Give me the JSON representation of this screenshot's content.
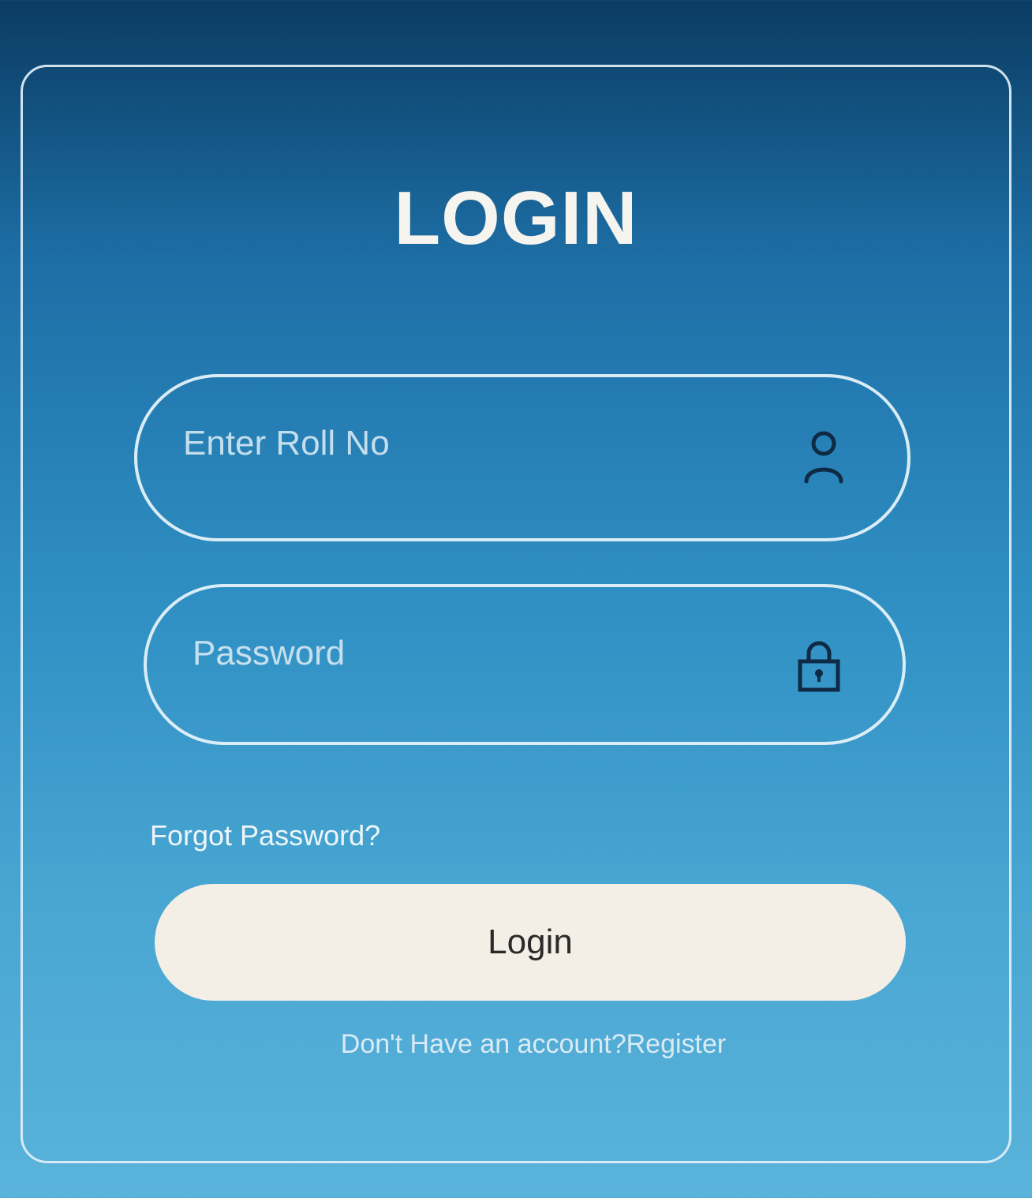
{
  "form": {
    "title": "LOGIN",
    "roll_field": {
      "placeholder": "Enter Roll No",
      "value": "",
      "icon": "user-icon"
    },
    "password_field": {
      "placeholder": "Password",
      "value": "",
      "icon": "lock-icon"
    },
    "forgot_link": "Forgot Password?",
    "login_button": "Login",
    "register_prompt": "Don't Have an account?",
    "register_link": "Register"
  },
  "colors": {
    "background_top": "#0b3c63",
    "background_bottom": "#5ab3da",
    "border": "#e4f2fa",
    "button_bg": "#f4efe6",
    "icon": "#0e2a44"
  }
}
